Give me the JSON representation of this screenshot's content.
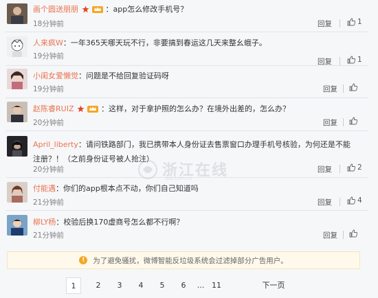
{
  "comments": [
    {
      "user": "画个圆送朋朋",
      "has_star": true,
      "has_vip": true,
      "text": "：app怎么修改手机号？",
      "time": "18分钟前",
      "reply": "回复",
      "likes": "1"
    },
    {
      "user": "人来疯W",
      "has_star": false,
      "has_vip": false,
      "text": "：一年365天哪天玩不行，非要搞到春运这几天来整幺蛾子。",
      "time": "19分钟前",
      "reply": "回复",
      "likes": "1"
    },
    {
      "user": "小闺女爱懒觉",
      "has_star": false,
      "has_vip": false,
      "text": "：问题是不给回复验证码呀",
      "time": "19分钟前",
      "reply": "回复",
      "likes": ""
    },
    {
      "user": "赵陈睿RUIZ",
      "has_star": true,
      "has_vip": true,
      "text": "：这样，对于拿护照的怎么办？在境外出差的，怎么办？",
      "time": "20分钟前",
      "reply": "回复",
      "likes": ""
    },
    {
      "user": "April_liberty",
      "has_star": false,
      "has_vip": false,
      "text": "：请问铁路部门，我已携带本人身份证去售票窗口办理手机号核验，为何还是不能注册？！（之前身份证号被人抢注）",
      "time": "20分钟前",
      "reply": "回复",
      "likes": "2"
    },
    {
      "user": "付能遇",
      "has_star": false,
      "has_vip": false,
      "text": "：你们的app根本点不动，你们自己知道吗",
      "time": "21分钟前",
      "reply": "回复",
      "likes": "4"
    },
    {
      "user": "柳LY杨",
      "has_star": false,
      "has_vip": false,
      "text": "：校验后换170虚商号怎么都不行啊？",
      "time": "21分钟前",
      "reply": "回复",
      "likes": ""
    }
  ],
  "notice": {
    "icon": "!",
    "text": "为了避免骚扰，微博智能反垃圾系统会过滤掉部分广告用户。"
  },
  "pager": {
    "pages": [
      "1",
      "2",
      "3",
      "4",
      "5",
      "6",
      "...",
      "11"
    ],
    "next": "下一页",
    "current": "1"
  },
  "watermark": {
    "text": "浙江在线",
    "sub": "zjol.com.cn"
  },
  "colors": {
    "username": "#eb7350",
    "text": "#333333",
    "meta": "#808080",
    "notice_bg": "#fef9eb",
    "star": "#e8431f",
    "vip": "#f6a623"
  }
}
